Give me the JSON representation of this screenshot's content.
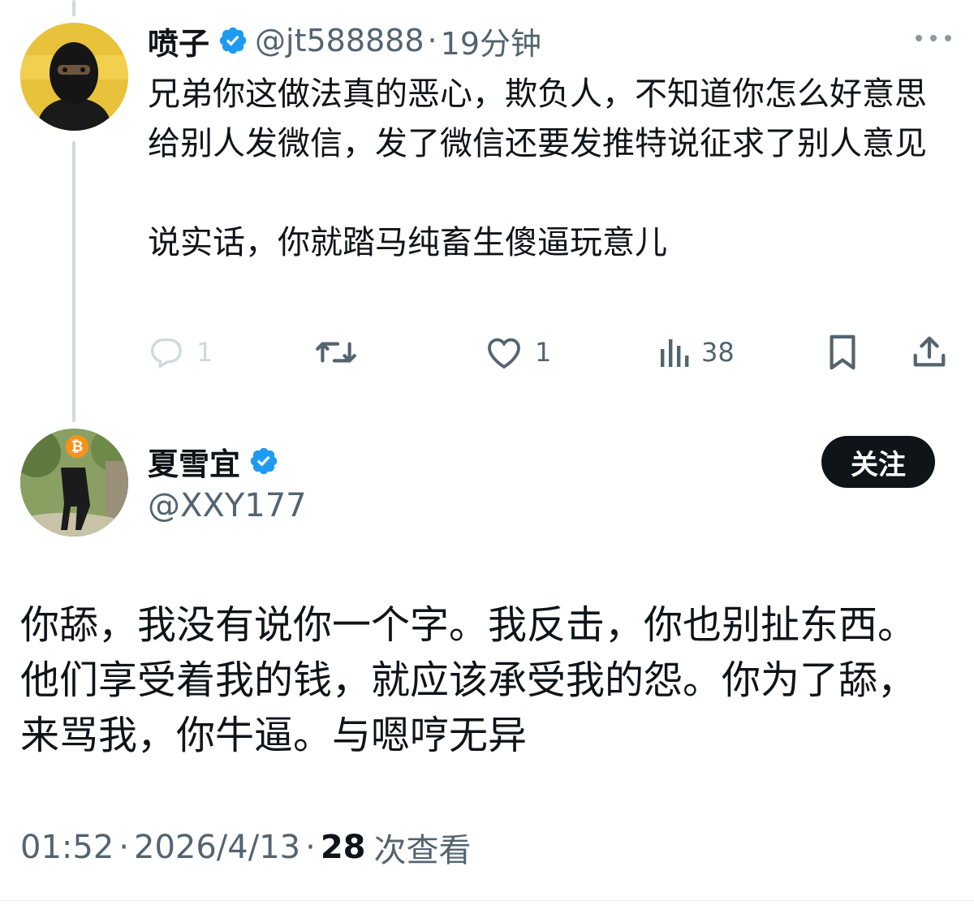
{
  "reply": {
    "name": "喷子",
    "handle": "@jt588888",
    "separator": "·",
    "time": "19分钟",
    "text": "兄弟你这做法真的恶心，欺负人，不知道你怎么好意思给别人发微信，发了微信还要发推特说征求了别人意见\n\n说实话，你就踏马纯畜生傻逼玩意儿",
    "avatar_icon": "masked-person-avatar",
    "more_icon": "more-dots-icon",
    "actions": {
      "reply_count": "1",
      "retweet_count": "",
      "like_count": "1",
      "views_count": "38"
    }
  },
  "main": {
    "name": "夏雪宜",
    "handle": "@XXY177",
    "follow_label": "关注",
    "text": "你舔，我没有说你一个字。我反击，你也别扯东西。他们享受着我的钱，就应该承受我的怨。你为了舔，来骂我，你牛逼。与嗯哼无异",
    "avatar_icon": "bitcoin-person-avatar",
    "meta_time": "01:52",
    "meta_sep1": "·",
    "meta_date": "2026/4/13",
    "meta_sep2": "·",
    "meta_views": "28",
    "meta_views_label": "次查看"
  },
  "colors": {
    "verified": "#1d9bf0",
    "text": "#0f1419",
    "secondary": "#536471",
    "thread_line": "#cfd9de",
    "button_bg": "#0f1419"
  }
}
